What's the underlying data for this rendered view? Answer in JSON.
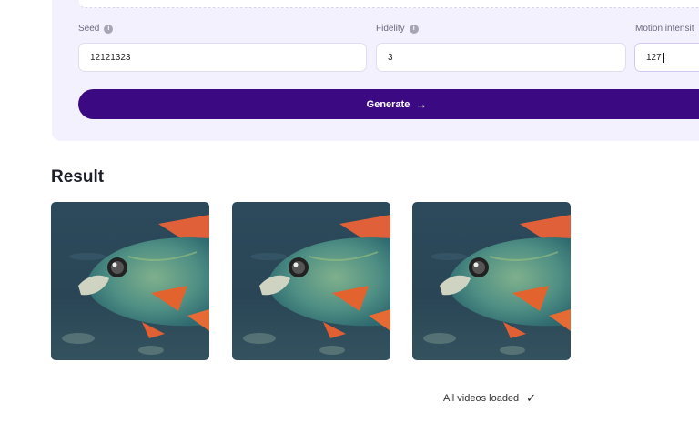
{
  "settings": {
    "seed": {
      "label": "Seed",
      "value": "12121323"
    },
    "fidelity": {
      "label": "Fidelity",
      "value": "3"
    },
    "motion": {
      "label": "Motion intensit",
      "value": "127"
    },
    "info_icon": "info-icon"
  },
  "generate_button": {
    "label": "Generate",
    "icon": "arrow-right-icon"
  },
  "result": {
    "title": "Result",
    "videos": [
      {
        "subject": "fish"
      },
      {
        "subject": "fish"
      },
      {
        "subject": "fish"
      }
    ],
    "status_text": "All videos loaded",
    "status_icon": "check-icon"
  },
  "colors": {
    "accent": "#3b0a82",
    "panel_bg": "#f3f1fd"
  }
}
